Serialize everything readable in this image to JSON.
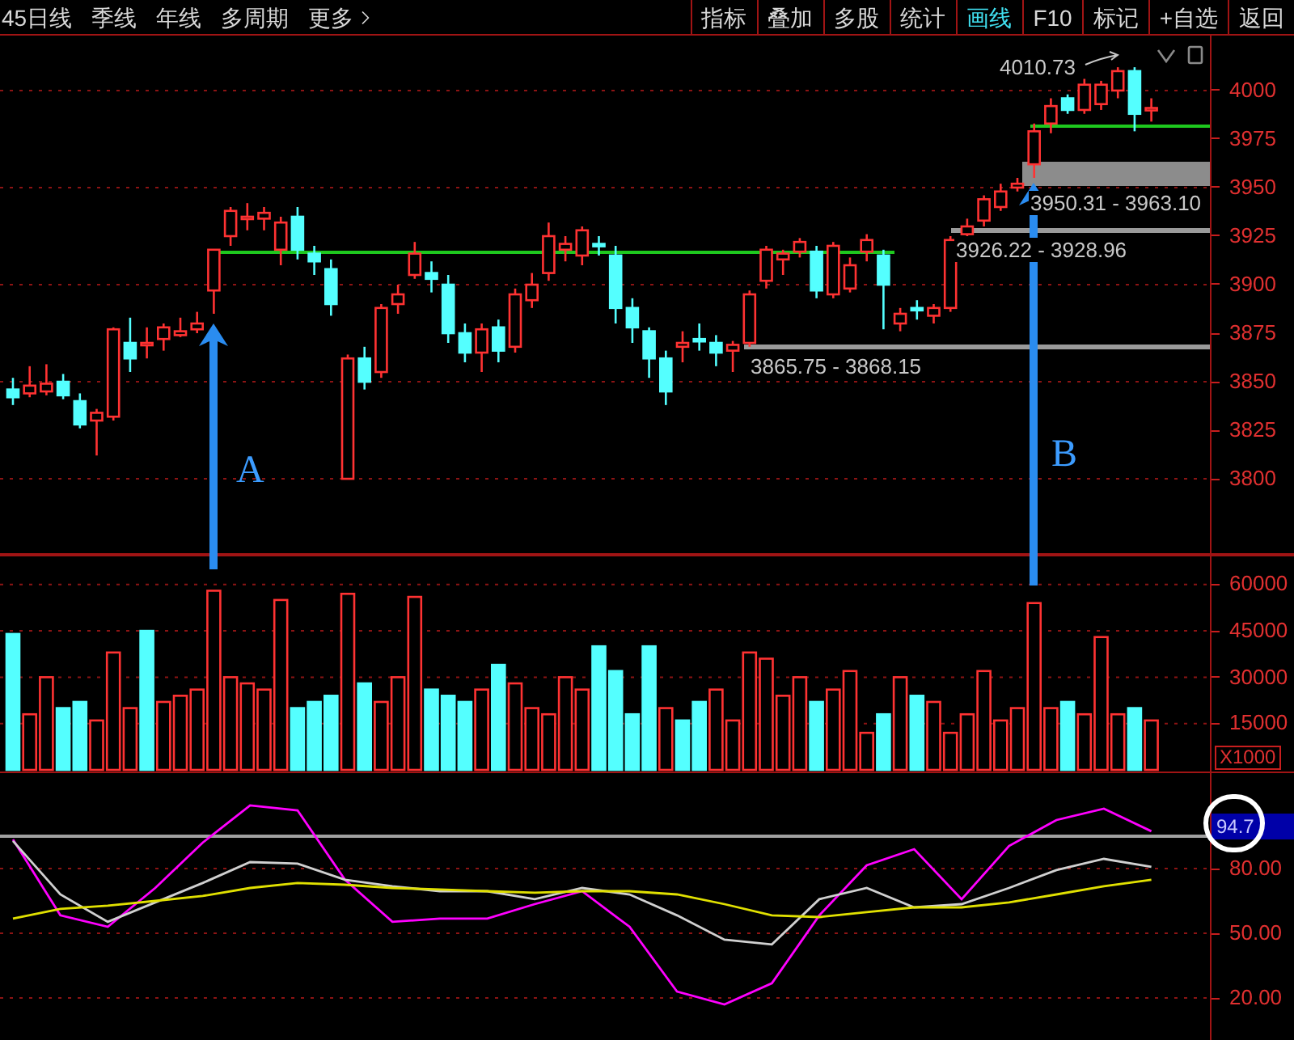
{
  "toolbar": {
    "left_items": [
      {
        "label": "45日线",
        "kind": "period"
      },
      {
        "label": "季线",
        "kind": "period"
      },
      {
        "label": "年线",
        "kind": "period"
      },
      {
        "label": "多周期",
        "kind": "period"
      },
      {
        "label": "更多",
        "kind": "menu"
      }
    ],
    "buttons": [
      {
        "label": "指标",
        "selected": false
      },
      {
        "label": "叠加",
        "selected": false
      },
      {
        "label": "多股",
        "selected": false
      },
      {
        "label": "统计",
        "selected": false
      },
      {
        "label": "画线",
        "selected": true
      },
      {
        "label": "F10",
        "selected": false
      },
      {
        "label": "标记",
        "selected": false
      },
      {
        "label": "+自选",
        "selected": false
      },
      {
        "label": "返回",
        "selected": false
      }
    ]
  },
  "price_chart": {
    "annotations": [
      {
        "kind": "high",
        "text": "4010.73"
      },
      {
        "kind": "band",
        "text": "3950.31 - 3963.10"
      },
      {
        "kind": "line",
        "text": "3926.22 - 3928.96"
      },
      {
        "kind": "line",
        "text": "3865.75 - 3868.15"
      }
    ],
    "markers": [
      {
        "label": "A"
      },
      {
        "label": "B"
      }
    ],
    "chart_data": {
      "type": "candlestick",
      "grid": true,
      "ylim": [
        3761.7,
        4028.3
      ],
      "yticks": [
        {
          "value": 4000,
          "label": "4000"
        },
        {
          "value": 3975,
          "label": "3975"
        },
        {
          "value": 3950,
          "label": "3950"
        },
        {
          "value": 3925,
          "label": "3925"
        },
        {
          "value": 3900,
          "label": "3900"
        },
        {
          "value": 3875,
          "label": "3875"
        },
        {
          "value": 3850,
          "label": "3850"
        },
        {
          "value": 3825,
          "label": "3825"
        },
        {
          "value": 3800,
          "label": "3800"
        }
      ],
      "ohlc": [
        [
          3846,
          3852,
          3838,
          3842
        ],
        [
          3844,
          3858,
          3842,
          3848
        ],
        [
          3845,
          3859,
          3843,
          3849
        ],
        [
          3850,
          3854,
          3841,
          3843
        ],
        [
          3840,
          3844,
          3826,
          3828
        ],
        [
          3830,
          3836,
          3812,
          3834
        ],
        [
          3832,
          3878,
          3830,
          3877
        ],
        [
          3870,
          3883,
          3855,
          3862
        ],
        [
          3869,
          3878,
          3862,
          3870
        ],
        [
          3872,
          3880,
          3866,
          3878
        ],
        [
          3874,
          3883,
          3873,
          3876
        ],
        [
          3877,
          3886,
          3875,
          3880
        ],
        [
          3897,
          3918,
          3885,
          3918
        ],
        [
          3925,
          3940,
          3920,
          3938
        ],
        [
          3934,
          3942,
          3928,
          3935
        ],
        [
          3934,
          3940,
          3928,
          3937
        ],
        [
          3918,
          3935,
          3910,
          3932
        ],
        [
          3935,
          3940,
          3913,
          3918
        ],
        [
          3916,
          3920,
          3905,
          3912
        ],
        [
          3908,
          3913,
          3884,
          3890
        ],
        [
          3800,
          3864,
          3800,
          3862
        ],
        [
          3862,
          3868,
          3846,
          3850
        ],
        [
          3855,
          3890,
          3852,
          3888
        ],
        [
          3890,
          3900,
          3885,
          3895
        ],
        [
          3905,
          3922,
          3903,
          3916
        ],
        [
          3906,
          3912,
          3896,
          3903
        ],
        [
          3900,
          3905,
          3870,
          3875
        ],
        [
          3875,
          3880,
          3860,
          3865
        ],
        [
          3865,
          3880,
          3855,
          3877
        ],
        [
          3878,
          3882,
          3860,
          3866
        ],
        [
          3868,
          3898,
          3865,
          3895
        ],
        [
          3892,
          3906,
          3888,
          3900
        ],
        [
          3906,
          3932,
          3902,
          3925
        ],
        [
          3918,
          3925,
          3912,
          3921
        ],
        [
          3915,
          3930,
          3910,
          3928
        ],
        [
          3921,
          3925,
          3915,
          3920
        ],
        [
          3915,
          3920,
          3880,
          3888
        ],
        [
          3888,
          3893,
          3870,
          3878
        ],
        [
          3876,
          3878,
          3852,
          3862
        ],
        [
          3862,
          3866,
          3838,
          3845
        ],
        [
          3868,
          3876,
          3860,
          3870
        ],
        [
          3872,
          3880,
          3866,
          3871
        ],
        [
          3870,
          3874,
          3858,
          3865
        ],
        [
          3866,
          3871,
          3855,
          3869
        ],
        [
          3870,
          3897,
          3868,
          3895
        ],
        [
          3902,
          3920,
          3898,
          3918
        ],
        [
          3913,
          3918,
          3905,
          3916
        ],
        [
          3917,
          3924,
          3914,
          3922
        ],
        [
          3917,
          3920,
          3893,
          3897
        ],
        [
          3895,
          3922,
          3893,
          3920
        ],
        [
          3898,
          3914,
          3896,
          3910
        ],
        [
          3917,
          3926,
          3912,
          3923
        ],
        [
          3915,
          3918,
          3877,
          3900
        ],
        [
          3880,
          3888,
          3876,
          3885
        ],
        [
          3888,
          3892,
          3882,
          3887
        ],
        [
          3884,
          3890,
          3880,
          3888
        ],
        [
          3888,
          3925,
          3886,
          3923
        ],
        [
          3926,
          3934,
          3925,
          3930
        ],
        [
          3933,
          3946,
          3930,
          3944
        ],
        [
          3940,
          3952,
          3938,
          3948
        ],
        [
          3950,
          3955,
          3948,
          3952
        ],
        [
          3962,
          3983,
          3955,
          3979
        ],
        [
          3983,
          3996,
          3978,
          3992
        ],
        [
          3996,
          3998,
          3988,
          3990
        ],
        [
          3990,
          4006,
          3988,
          4003
        ],
        [
          3993,
          4005,
          3990,
          4003
        ],
        [
          4000,
          4012,
          3996,
          4010
        ],
        [
          4010,
          4012,
          3979,
          3988
        ],
        [
          3990,
          3996,
          3984,
          3991
        ]
      ]
    }
  },
  "volume_chart": {
    "axis_unit": "X1000",
    "chart_data": {
      "type": "bar",
      "grid": true,
      "ylim": [
        0,
        69110
      ],
      "yticks": [
        {
          "value": 60000,
          "label": "60000"
        },
        {
          "value": 45000,
          "label": "45000"
        },
        {
          "value": 30000,
          "label": "30000"
        },
        {
          "value": 15000,
          "label": "15000"
        }
      ],
      "series": [
        {
          "color": "#ff3232",
          "values": [
            null,
            18000,
            30000,
            null,
            null,
            16000,
            38000,
            20000,
            null,
            22000,
            24000,
            26000,
            58000,
            30000,
            28000,
            26000,
            55000,
            null,
            null,
            null,
            57000,
            null,
            22000,
            30000,
            56000,
            null,
            null,
            null,
            26000,
            null,
            28000,
            20000,
            18000,
            30000,
            26000,
            null,
            null,
            null,
            null,
            20000,
            null,
            null,
            26000,
            16000,
            38000,
            36000,
            24000,
            30000,
            null,
            26000,
            32000,
            12000,
            null,
            30000,
            null,
            22000,
            12000,
            18000,
            32000,
            16000,
            20000,
            54000,
            20000,
            null,
            18000,
            43000,
            18000,
            null,
            16000
          ]
        },
        {
          "color": "#54ffff",
          "values": [
            44000,
            null,
            null,
            20000,
            22000,
            null,
            null,
            null,
            45000,
            null,
            null,
            null,
            null,
            null,
            null,
            null,
            null,
            20000,
            22000,
            24000,
            null,
            28000,
            null,
            null,
            null,
            26000,
            24000,
            22000,
            null,
            34000,
            null,
            null,
            null,
            null,
            null,
            40000,
            32000,
            18000,
            40000,
            null,
            16000,
            22000,
            null,
            null,
            null,
            null,
            null,
            null,
            22000,
            null,
            null,
            null,
            18000,
            null,
            24000,
            null,
            null,
            null,
            null,
            null,
            null,
            null,
            null,
            22000,
            null,
            null,
            null,
            20000,
            null
          ]
        }
      ]
    }
  },
  "indicator_chart": {
    "current_value": "94.7",
    "chart_data": {
      "type": "line",
      "grid": true,
      "ylim": [
        0.5,
        124.25
      ],
      "yticks": [
        {
          "value": 80,
          "label": "80.00"
        },
        {
          "value": 50,
          "label": "50.00"
        },
        {
          "value": 20,
          "label": "20.00"
        }
      ],
      "series": [
        {
          "color": "#ff00ff",
          "values": [
            93.5,
            58.3,
            53,
            71,
            92,
            109.3,
            107,
            74.8,
            55.3,
            56.8,
            56.8,
            63.5,
            69.5,
            53,
            23,
            17,
            26.8,
            58.3,
            81.5,
            89,
            65.8,
            90.5,
            102.5,
            107.8,
            97.3
          ]
        },
        {
          "color": "#d0d0d0",
          "values": [
            92.8,
            68,
            55.3,
            64.3,
            73.3,
            83,
            82.3,
            74.8,
            71.8,
            69.5,
            69.5,
            65.8,
            71,
            68,
            58.3,
            47,
            44.8,
            65.8,
            71,
            62,
            63.5,
            71,
            79.3,
            84.5,
            80.8
          ]
        },
        {
          "color": "#e0e000",
          "values": [
            56.8,
            61.3,
            62.8,
            65,
            67.3,
            71,
            73.3,
            72.5,
            71,
            70.3,
            69.5,
            68.8,
            69.5,
            69.5,
            68,
            63.5,
            58.3,
            57.5,
            59.8,
            62,
            62,
            64.3,
            68,
            71.8,
            74.8
          ]
        }
      ]
    }
  }
}
